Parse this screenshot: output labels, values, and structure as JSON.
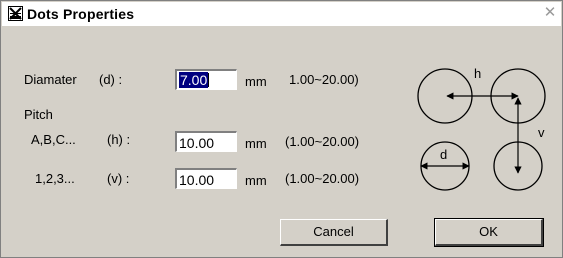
{
  "window": {
    "title": "Dots Properties",
    "icon": "dots-properties-icon",
    "close_icon": "close-icon"
  },
  "diameter": {
    "label": "Diamater",
    "symbol": "(d) :",
    "value": "7.00",
    "unit": "mm",
    "range": "1.00~20.00)"
  },
  "pitch": {
    "heading": "Pitch",
    "h": {
      "label": "A,B,C...",
      "symbol": "(h) :",
      "value": "10.00",
      "unit": "mm",
      "range": "(1.00~20.00)"
    },
    "v": {
      "label": "1,2,3...",
      "symbol": "(v) :",
      "value": "10.00",
      "unit": "mm",
      "range": "(1.00~20.00)"
    }
  },
  "diagram": {
    "h_label": "h",
    "v_label": "v",
    "d_label": "d"
  },
  "buttons": {
    "cancel": "Cancel",
    "ok": "OK"
  }
}
